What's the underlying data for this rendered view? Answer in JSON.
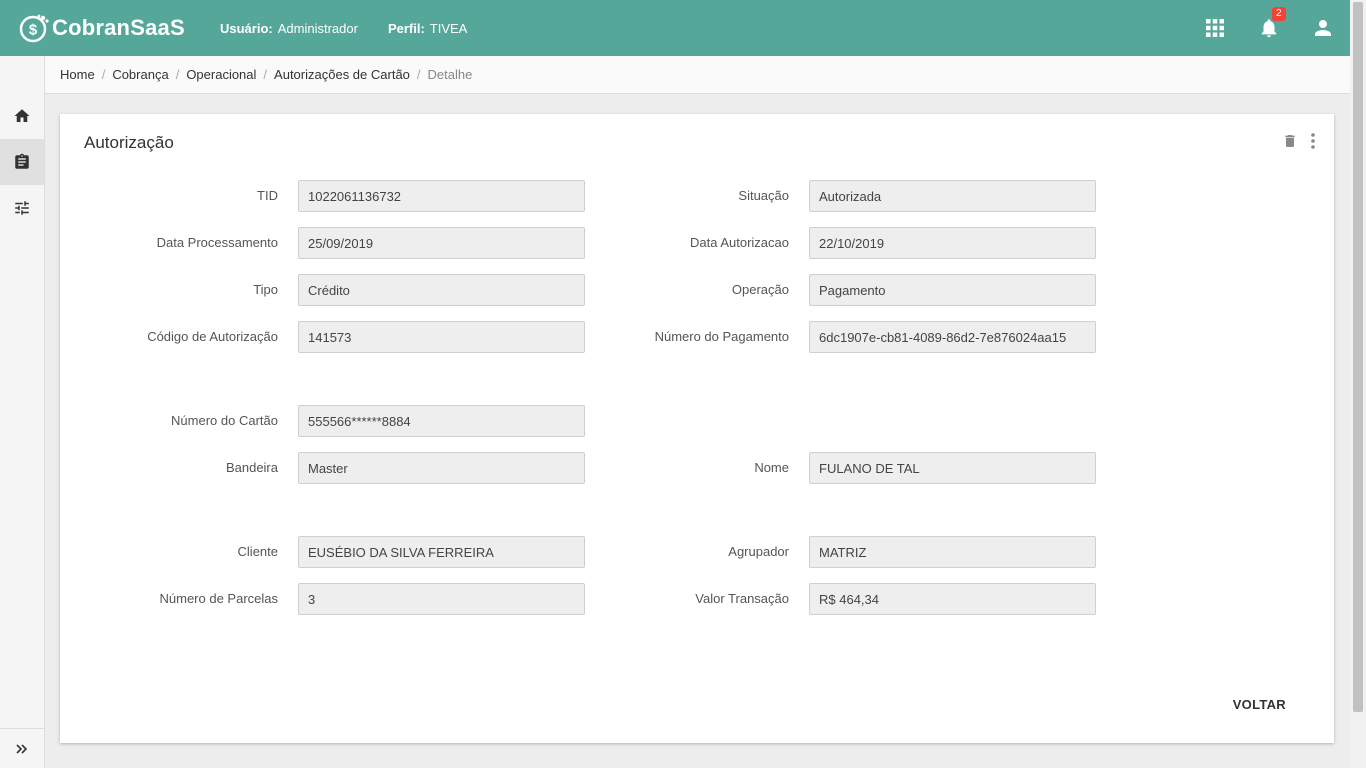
{
  "app": {
    "name": "CobranSaaS"
  },
  "header": {
    "user_label": "Usuário:",
    "user_value": "Administrador",
    "profile_label": "Perfil:",
    "profile_value": "TIVEA",
    "notification_count": "2",
    "icons": [
      "apps-grid-icon",
      "bell-icon",
      "account-icon"
    ],
    "bg_color": "#55a899"
  },
  "sidebar": {
    "items": [
      {
        "name": "home",
        "icon": "home-icon"
      },
      {
        "name": "clipboard",
        "icon": "clipboard-icon",
        "active": true
      },
      {
        "name": "settings",
        "icon": "sliders-icon"
      }
    ],
    "expand_icon": "double-chevron-right-icon"
  },
  "breadcrumb": {
    "items": [
      "Home",
      "Cobrança",
      "Operacional",
      "Autorizações de Cartão"
    ],
    "current": "Detalhe"
  },
  "card": {
    "title": "Autorização",
    "back_label": "VOLTAR",
    "fields": {
      "tid": {
        "label": "TID",
        "value": "1022061136732"
      },
      "situacao": {
        "label": "Situação",
        "value": "Autorizada"
      },
      "data_processamento": {
        "label": "Data Processamento",
        "value": "25/09/2019"
      },
      "data_autorizacao": {
        "label": "Data Autorizacao",
        "value": "22/10/2019"
      },
      "tipo": {
        "label": "Tipo",
        "value": "Crédito"
      },
      "operacao": {
        "label": "Operação",
        "value": "Pagamento"
      },
      "codigo_autorizacao": {
        "label": "Código de Autorização",
        "value": "141573"
      },
      "numero_pagamento": {
        "label": "Número do Pagamento",
        "value": "6dc1907e-cb81-4089-86d2-7e876024aa15"
      },
      "numero_cartao": {
        "label": "Número do Cartão",
        "value": "555566******8884"
      },
      "bandeira": {
        "label": "Bandeira",
        "value": "Master"
      },
      "nome": {
        "label": "Nome",
        "value": "FULANO DE TAL"
      },
      "cliente": {
        "label": "Cliente",
        "value": "EUSÉBIO DA SILVA FERREIRA"
      },
      "agrupador": {
        "label": "Agrupador",
        "value": "MATRIZ"
      },
      "numero_parcelas": {
        "label": "Número de Parcelas",
        "value": "3"
      },
      "valor_transacao": {
        "label": "Valor Transação",
        "value": "R$ 464,34"
      }
    }
  }
}
